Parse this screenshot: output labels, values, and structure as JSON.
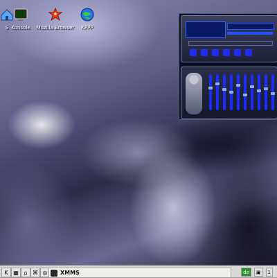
{
  "desktop_icons": [
    {
      "label": "S",
      "icon": "home-folder-icon",
      "x": 0
    },
    {
      "label": "Konsole",
      "icon": "terminal-icon",
      "x": 0
    },
    {
      "label": "Mozilla Browser",
      "icon": "mozilla-icon",
      "x": 0
    },
    {
      "label": "KPPP",
      "icon": "globe-icon",
      "x": 0
    }
  ],
  "taskbar": {
    "task_label": "XMMS",
    "tray_flag": "de",
    "tray_clock": "1"
  },
  "colors": {
    "xmms_blue": "#2850ff",
    "taskbar": "#d8d8d4"
  }
}
